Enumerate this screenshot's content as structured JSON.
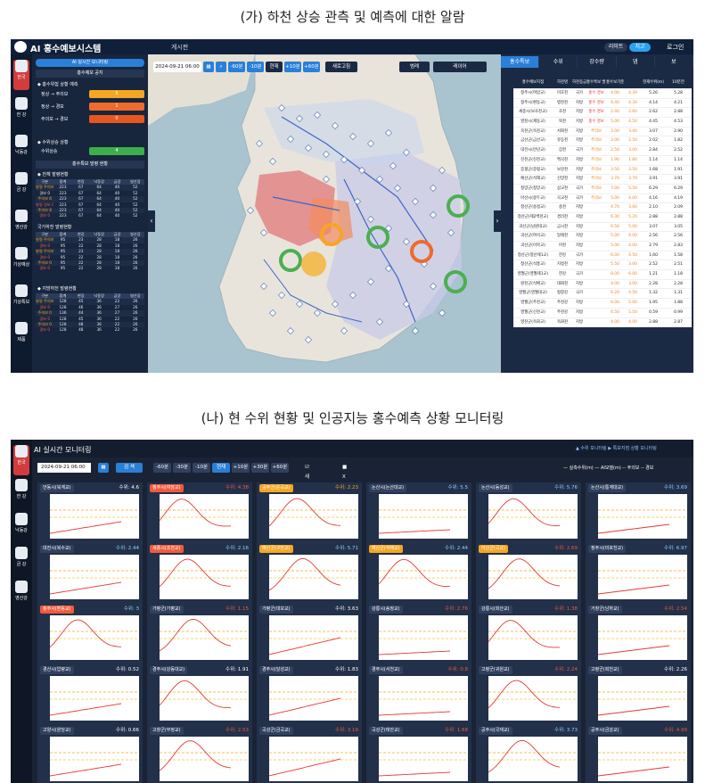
{
  "captions": {
    "a": "(가) 하천 상승 관측 및 예측에 대한 알람",
    "b": "(나) 현 수위 현황 및 인공지능 홍수예측 상황 모니터링"
  },
  "panel_a": {
    "title": "AI 홍수예보시스템",
    "board": "게시판",
    "pill1": "리미트",
    "pill2": "치고",
    "login": "로그인",
    "nav": [
      {
        "label": "한국",
        "icon": "korea-map-icon"
      },
      {
        "label": "한 강",
        "icon": "han-river-icon"
      },
      {
        "label": "낙동강",
        "icon": "nakdong-icon"
      },
      {
        "label": "금 강",
        "icon": "geum-icon"
      },
      {
        "label": "영산강",
        "icon": "yeongsan-icon"
      },
      {
        "label": "기상예상",
        "icon": "weather-icon"
      },
      {
        "label": "기상특보",
        "icon": "weather-alert-icon"
      },
      {
        "label": "제품",
        "icon": "product-icon"
      }
    ],
    "side": {
      "ai_button": "AI 실시간 모니터링",
      "status_bar": "홍수예보 공지",
      "alert_head": "◆ 홍수위험 상황 예측",
      "alerts": [
        {
          "k": "정상 → 주의보",
          "v": "5",
          "color": "#f5a623"
        },
        {
          "k": "정상 → 경보",
          "v": "1",
          "color": "#f06a2a"
        },
        {
          "k": "주의보 → 경보",
          "v": "0",
          "color": "#e8561f"
        }
      ],
      "rise_head": "◆ 수위상승 상황",
      "rise": {
        "k": "수위상승",
        "v": "4",
        "color": "#3cae4a"
      },
      "issue_bar": "홍수특보 발령 현황",
      "all_head": "◆ 전체 발령현황",
      "cols": [
        "구분",
        "합계",
        "한강",
        "낙동강",
        "금강",
        "영산강"
      ],
      "tables": [
        [
          [
            "발령",
            "주의보 8",
            "223",
            "67",
            "64",
            "40",
            "52"
          ],
          [
            "경보",
            "0",
            "223",
            "67",
            "64",
            "40",
            "52"
          ],
          [
            "",
            "주의보 8",
            "223",
            "67",
            "64",
            "40",
            "52"
          ],
          [
            "발령",
            "경보 0",
            "223",
            "67",
            "64",
            "40",
            "52"
          ],
          [
            "",
            "주의보 8",
            "223",
            "67",
            "64",
            "40",
            "52"
          ],
          [
            "",
            "경보 0",
            "223",
            "67",
            "64",
            "40",
            "52"
          ]
        ],
        [
          [
            "발령",
            "주의보 0",
            "95",
            "23",
            "28",
            "18",
            "26"
          ],
          [
            "",
            "경보 0",
            "95",
            "22",
            "28",
            "18",
            "26"
          ],
          [
            "발령",
            "주의보 0",
            "95",
            "23",
            "28",
            "18",
            "26"
          ],
          [
            "",
            "경보 0",
            "95",
            "22",
            "28",
            "18",
            "26"
          ],
          [
            "",
            "주의보 0",
            "95",
            "22",
            "28",
            "18",
            "26"
          ],
          [
            "",
            "경보 0",
            "95",
            "22",
            "28",
            "18",
            "26"
          ]
        ],
        [
          [
            "발령",
            "주의보 0",
            "128",
            "45",
            "36",
            "22",
            "26"
          ],
          [
            "",
            "경보 0",
            "128",
            "46",
            "36",
            "27",
            "26"
          ],
          [
            "",
            "주의보 0",
            "136",
            "44",
            "36",
            "27",
            "26"
          ],
          [
            "",
            "경보 0",
            "128",
            "45",
            "36",
            "22",
            "26"
          ],
          [
            "",
            "주의보 0",
            "128",
            "48",
            "36",
            "22",
            "26"
          ],
          [
            "",
            "경보 0",
            "128",
            "48",
            "36",
            "22",
            "26"
          ]
        ]
      ],
      "national_head": "국가하천 발령현황",
      "local_head": "◆ 지방하천 발령현황"
    },
    "map": {
      "datetime": "2024-09-21 06:00",
      "btns": [
        "-60분",
        "-10분",
        "현재",
        "+10분",
        "+60분"
      ],
      "refresh": "새로고침",
      "layer1": "범례",
      "layer2": "레이어"
    },
    "right": {
      "tabs": [
        "홍수특보",
        "수위",
        "강수량",
        "댐",
        "보"
      ],
      "header": [
        "홍수예보지점",
        "하천명",
        "하천등급",
        "홍수특보 발령현황",
        "홍수보기준수위",
        "",
        "현재수위(m)",
        "10분전"
      ],
      "rows": [
        [
          "청주시(여암교)",
          "미호천",
          "국가",
          "홍수 경보",
          "4.00",
          "4.30",
          "5.26",
          "5.28"
        ],
        [
          "청주시(환동교)",
          "병천천",
          "지방",
          "홍수 경보",
          "4.40",
          "4.30",
          "4.14",
          "4.21"
        ],
        [
          "세종시(보조천교)",
          "조천",
          "지방",
          "홍수 경보",
          "2.40",
          "2.60",
          "2.62",
          "2.88"
        ],
        [
          "영천시(제동교)",
          "북천",
          "지방",
          "홍수 경보",
          "5.00",
          "4.50",
          "4.45",
          "4.53"
        ],
        [
          "옥천군(옥천교)",
          "서화천",
          "지방",
          "주의보",
          "3.00",
          "3.40",
          "3.07",
          "2.90"
        ],
        [
          "금산군(금산교)",
          "유등천",
          "지방",
          "주의보",
          "3.00",
          "2.50",
          "2.02",
          "1.82"
        ],
        [
          "대전시(만년교)",
          "갑천",
          "국가",
          "주의보",
          "2.50",
          "3.00",
          "2.84",
          "2.52"
        ],
        [
          "진천군(진천교)",
          "백곡천",
          "지방",
          "주의보",
          "1.90",
          "1.80",
          "1.14",
          "1.14"
        ],
        [
          "증평군(증평교)",
          "보강천",
          "지방",
          "주의보",
          "3.50",
          "3.50",
          "1.68",
          "1.91"
        ],
        [
          "예산군(석해교)",
          "신양천",
          "지방",
          "주의보",
          "3.70",
          "3.70",
          "3.91",
          "3.91"
        ],
        [
          "청양군(청양교)",
          "삼교천",
          "국가",
          "주의보",
          "7.00",
          "5.50",
          "6.29",
          "6.29"
        ],
        [
          "아산시(용두교)",
          "곡교천",
          "국가",
          "주의보",
          "5.00",
          "4.00",
          "4.16",
          "4.19"
        ],
        [
          "청산군(송정교)",
          "송천",
          "지방",
          "",
          "4.70",
          "3.60",
          "2.10",
          "2.09"
        ],
        [
          "청산군(제2백천교)",
          "경리천",
          "지방",
          "",
          "6.30",
          "5.20",
          "2.88",
          "2.88"
        ],
        [
          "괴산군(남원대교)",
          "금시천",
          "지방",
          "",
          "6.50",
          "5.00",
          "3.07",
          "3.05"
        ],
        [
          "괴산군(여석교)",
          "달래천",
          "지방",
          "",
          "5.00",
          "4.00",
          "2.56",
          "2.56"
        ],
        [
          "괴산군(이목교)",
          "어천",
          "지방",
          "",
          "5.00",
          "4.00",
          "2.79",
          "2.83"
        ],
        [
          "청산군(청산제1교)",
          "한강",
          "국가",
          "",
          "6.00",
          "4.50",
          "1.60",
          "1.58"
        ],
        [
          "청산군(석흥교)",
          "지정천",
          "지방",
          "",
          "5.50",
          "3.00",
          "2.52",
          "2.51"
        ],
        [
          "영월군(영월제1교)",
          "한강",
          "국가",
          "",
          "8.00",
          "6.00",
          "1.21",
          "1.18"
        ],
        [
          "원천군(석배교)",
          "대화천",
          "지방",
          "",
          "4.00",
          "3.00",
          "2.28",
          "2.28"
        ],
        [
          "영월군(영월대교)",
          "평창강",
          "국가",
          "",
          "6.20",
          "4.50",
          "1.32",
          "1.31"
        ],
        [
          "영월군(주천교)",
          "주천강",
          "지방",
          "",
          "6.00",
          "5.00",
          "1.95",
          "1.88"
        ],
        [
          "영월군(신천교)",
          "주천강",
          "지방",
          "",
          "6.50",
          "5.50",
          "0.59",
          "0.99"
        ],
        [
          "영천군(옥화교)",
          "옥화천",
          "지방",
          "",
          "4.00",
          "4.00",
          "2.88",
          "2.87"
        ]
      ]
    }
  },
  "panel_b": {
    "title": "AI 실시간 모니터링",
    "breadcrumb": "▲ 수위 모니터링 ▶ 특보지점 상황 모니터링",
    "datetime": "2024-09-21 06:00",
    "search": "검 색",
    "btns": [
      "-60분",
      "-30분",
      "-10분",
      "현재",
      "+10분",
      "+30분",
      "+60분"
    ],
    "chk1": "새로고침",
    "chk2": "X축표시",
    "legend": "— 실측수위(m) — AI모델(m) -- 주의보 -- 경보",
    "panels": [
      {
        "name": "안동시(북계교)",
        "level": "수위: 4.6",
        "alert": "",
        "color": "#ffffff"
      },
      {
        "name": "청주시(여암교)",
        "level": "수위: 4.38",
        "alert": "red",
        "color": "#f05a3c"
      },
      {
        "name": "공주군(운곡교)",
        "level": "수위: 2.23",
        "alert": "orange",
        "color": "#f5a623"
      },
      {
        "name": "논산시(논산대교)",
        "level": "수위: 5.5",
        "alert": "",
        "color": "#8fd3ff"
      },
      {
        "name": "논산시(동성교)",
        "level": "수위: 5.76",
        "alert": "",
        "color": "#8fd3ff"
      },
      {
        "name": "논산시(통계대교)",
        "level": "수위: 3.69",
        "alert": "",
        "color": "#8fd3ff"
      },
      {
        "name": "대전시(복수교)",
        "level": "수위: 2.44",
        "alert": "",
        "color": "#8fd3ff"
      },
      {
        "name": "세종시(조천교)",
        "level": "수위: 2.16",
        "alert": "red",
        "color": "#8fd3ff"
      },
      {
        "name": "예산군(구만교)",
        "level": "수위: 5.71",
        "alert": "orange",
        "color": "#8fd3ff"
      },
      {
        "name": "예산군(석해교)",
        "level": "수위: 2.44",
        "alert": "orange",
        "color": "#8fd3ff"
      },
      {
        "name": "아산군(곡교)",
        "level": "수위: 2.69",
        "alert": "orange",
        "color": "#f05a3c"
      },
      {
        "name": "청주시(미호천교)",
        "level": "수위: 6.97",
        "alert": "",
        "color": "#8fd3ff"
      },
      {
        "name": "청주시(환동교)",
        "level": "수위: 3",
        "alert": "red",
        "color": "#8fd3ff"
      },
      {
        "name": "가평군(가평교)",
        "level": "수위: 1.15",
        "alert": "",
        "color": "#f05a3c"
      },
      {
        "name": "가평군(대보교)",
        "level": "수위: 3.63",
        "alert": "",
        "color": "#ffffff"
      },
      {
        "name": "강릉시(송정교)",
        "level": "수위: 2.76",
        "alert": "",
        "color": "#f05a3c"
      },
      {
        "name": "강릉시(회산교)",
        "level": "수위: 1.38",
        "alert": "",
        "color": "#f05a3c"
      },
      {
        "name": "거창군(남하교)",
        "level": "수위: 2.54",
        "alert": "",
        "color": "#f05a3c"
      },
      {
        "name": "경산시(압량교)",
        "level": "수위: 0.52",
        "alert": "",
        "color": "#ffffff"
      },
      {
        "name": "경주시(강동대교)",
        "level": "수위: 1.91",
        "alert": "",
        "color": "#ffffff"
      },
      {
        "name": "경주시(달성교)",
        "level": "수위: 1.83",
        "alert": "",
        "color": "#ffffff"
      },
      {
        "name": "경주시(서천교)",
        "level": "수위: 0.8",
        "alert": "",
        "color": "#f05a3c"
      },
      {
        "name": "고령군(귀원교)",
        "level": "수위: 2.24",
        "alert": "",
        "color": "#f05a3c"
      },
      {
        "name": "고령군(회천교)",
        "level": "수위: 2.26",
        "alert": "",
        "color": "#ffffff"
      },
      {
        "name": "고양시(원당교)",
        "level": "수위: 0.66",
        "alert": "",
        "color": "#ffffff"
      },
      {
        "name": "고창군(부정교)",
        "level": "수위: 2.53",
        "alert": "",
        "color": "#f05a3c"
      },
      {
        "name": "곡성군(금곡교)",
        "level": "수위: 3.19",
        "alert": "",
        "color": "#f05a3c"
      },
      {
        "name": "곡성군(태안교)",
        "level": "수위: 1.68",
        "alert": "",
        "color": "#f05a3c"
      },
      {
        "name": "공주시(국재교)",
        "level": "수위: 3.73",
        "alert": "",
        "color": "#8fd3ff"
      },
      {
        "name": "공주시(금강교)",
        "level": "수위: 4.99",
        "alert": "",
        "color": "#f05a3c"
      }
    ]
  }
}
